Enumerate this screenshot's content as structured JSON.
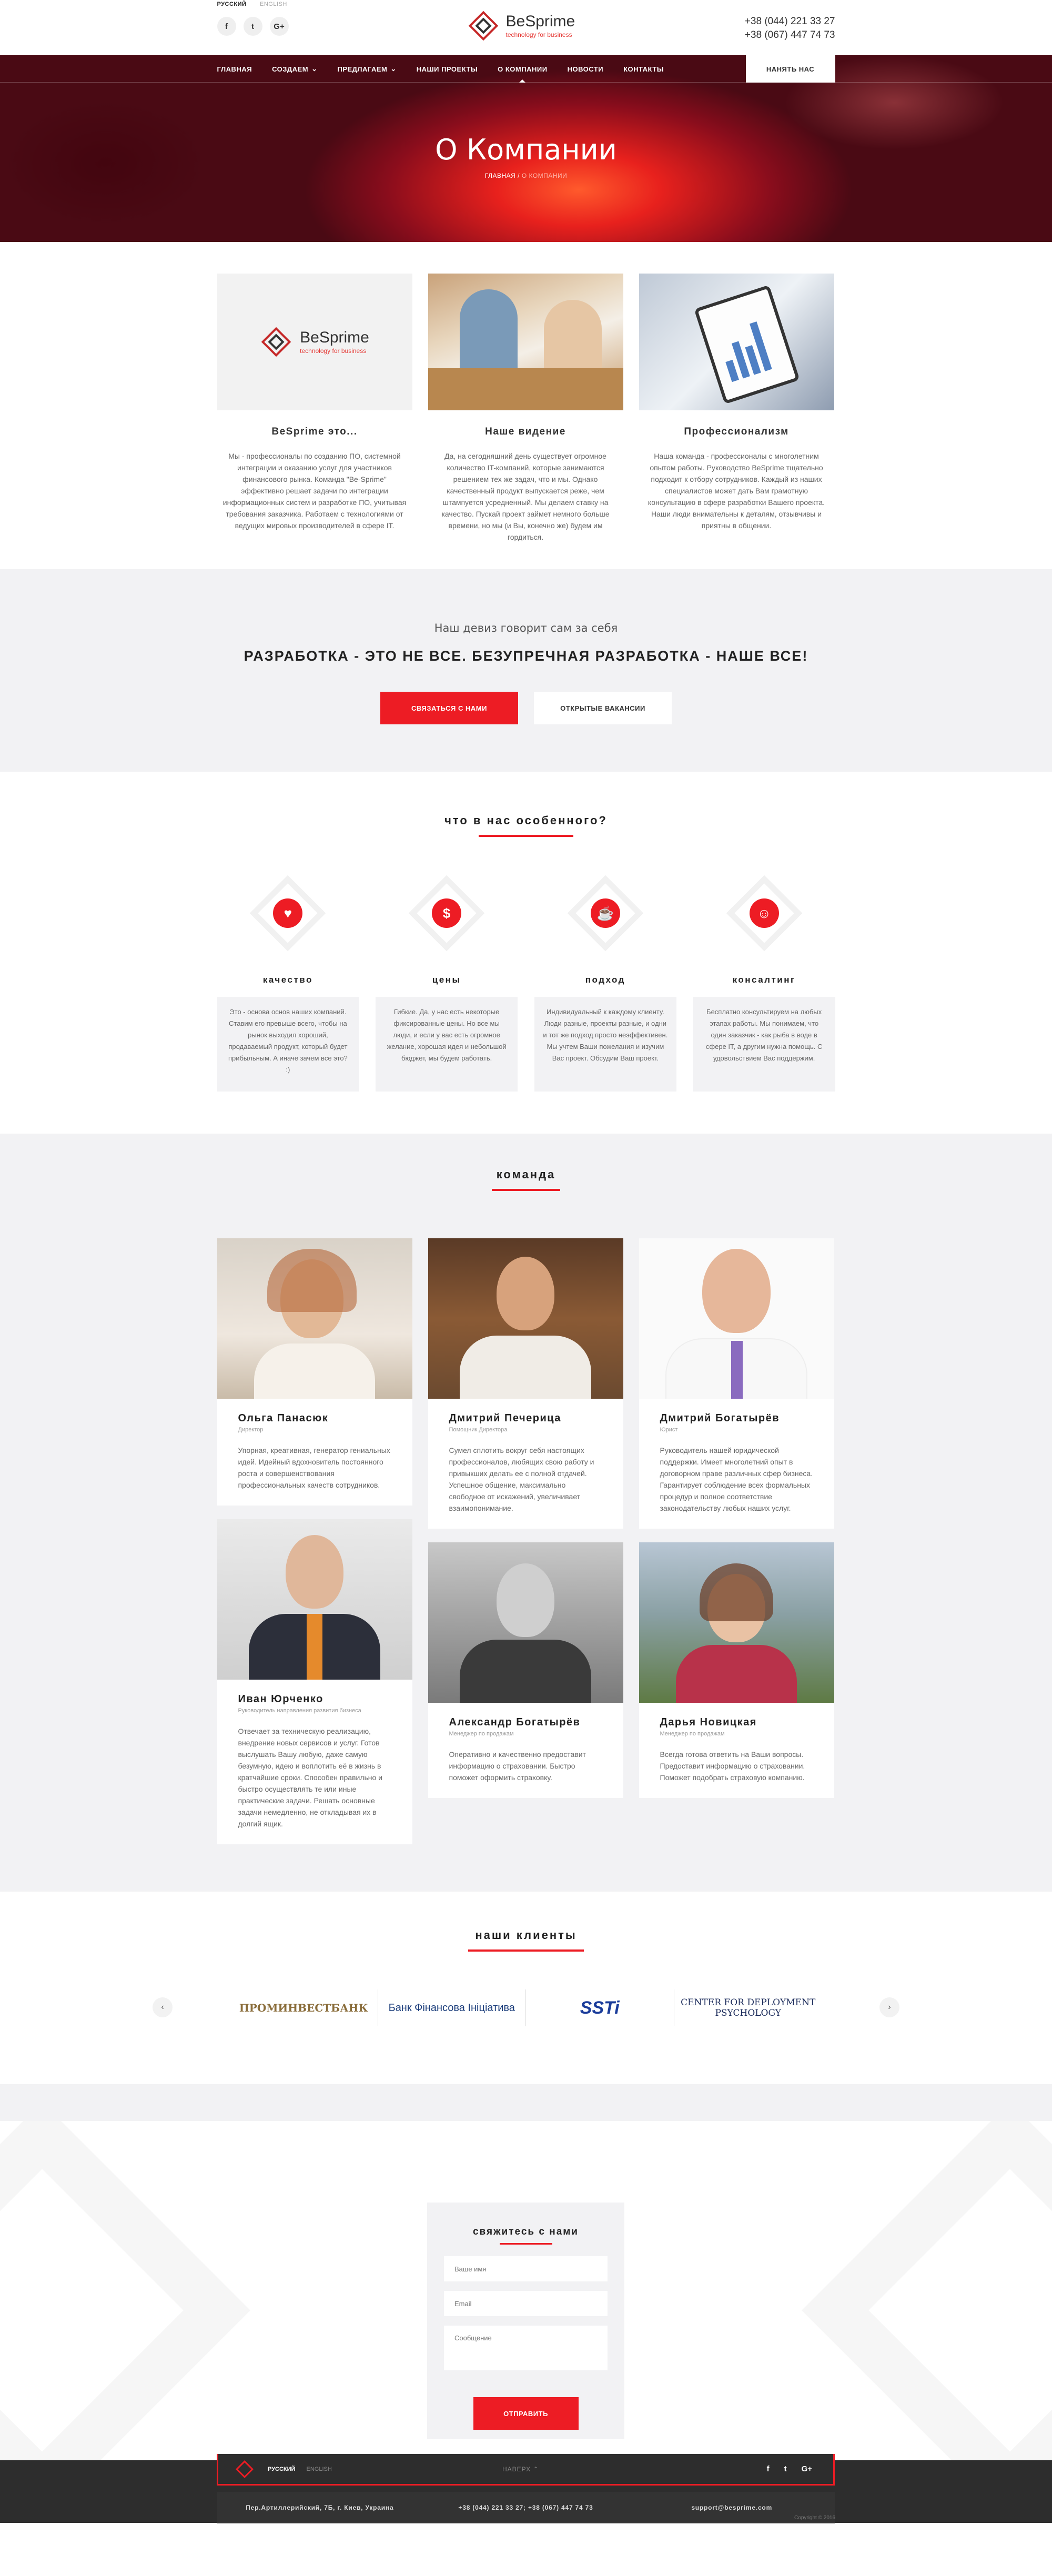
{
  "topbar": {
    "lang_active": "РУССКИЙ",
    "lang_other": "ENGLISH",
    "social": [
      "f",
      "t",
      "G+"
    ],
    "logo_name": "BeSprime",
    "logo_tagline": "technology for business",
    "phone1": "+38 (044) 221 33 27",
    "phone2": "+38 (067) 447 74 73"
  },
  "nav": {
    "items": [
      "ГЛАВНАЯ",
      "СОЗДАЕМ",
      "ПРЕДЛАГАЕМ",
      "НАШИ ПРОЕКТЫ",
      "О КОМПАНИИ",
      "НОВОСТИ",
      "КОНТАКТЫ"
    ],
    "hire": "НАНЯТЬ НАС"
  },
  "hero": {
    "title": "О Компании",
    "crumb_home": "ГЛАВНАЯ",
    "crumb_sep": " / ",
    "crumb_current": "О КОМПАНИИ"
  },
  "about": [
    {
      "title": "BeSprime это...",
      "text": "Мы - профессионалы по созданию ПО, системной интеграции и оказанию услуг для участников финансового рынка. Команда \"Be-Sprime\" эффективно решает задачи по интеграции информационных систем и разработке ПО, учитывая требования заказчика. Работаем с технологиями от ведущих мировых производителей в сфере IT."
    },
    {
      "title": "Наше видение",
      "text": "Да, на сегодняшний день существует огромное количество IT-компаний, которые занимаются решением тех же задач, что и мы. Однако качественный продукт выпускается реже, чем штампуется усредненный. Мы делаем ставку на качество. Пускай проект займет немного больше времени, но мы (и Вы, конечно же) будем им гордиться."
    },
    {
      "title": "Профессионализм",
      "text": "Наша команда - профессионалы с многолетним опытом работы. Руководство BeSprime тщательно подходит к отбору сотрудников. Каждый из наших специалистов может дать Вам грамотную консультацию в сфере разработки Вашего проекта. Наши люди внимательны к деталям, отзывчивы и приятны в общении."
    }
  ],
  "motto": {
    "subtitle": "Наш девиз говорит сам за себя",
    "main": "РАЗРАБОТКА - ЭТО НЕ ВСЕ. БЕЗУПРЕЧНАЯ РАЗРАБОТКА - НАШЕ ВСЕ!",
    "btn_contact": "СВЯЗАТЬСЯ С НАМИ",
    "btn_jobs": "ОТКРЫТЫЕ ВАКАНСИИ"
  },
  "features": {
    "title": "что в нас особенного?",
    "items": [
      {
        "title": "качество",
        "icon": "heart-hand-icon",
        "glyph": "♥",
        "text": "Это - основа основ наших компаний. Ставим его превыше всего, чтобы на рынок выходил хороший, продаваемый продукт, который будет прибыльным. А иначе зачем все это? :)"
      },
      {
        "title": "цены",
        "icon": "price-tag-icon",
        "glyph": "$",
        "text": "Гибкие. Да, у нас есть некоторые фиксированные цены. Но все мы люди, и если у вас есть огромное желание, хорошая идея и небольшой бюджет, мы будем работать."
      },
      {
        "title": "подход",
        "icon": "coffee-cup-icon",
        "glyph": "☕",
        "text": "Индивидуальный к каждому клиенту. Люди разные, проекты разные, и одни и тот же подход просто неэффективен. Мы учтем Ваши пожелания и изучим Вас проект. Обсудим Ваш проект."
      },
      {
        "title": "консалтинг",
        "icon": "consultant-icon",
        "glyph": "☺",
        "text": "Бесплатно консультируем на любых этапах работы. Мы понимаем, что один заказчик - как рыба в воде в сфере IT, а другим нужна помощь. С удовольствием Вас поддержим."
      }
    ]
  },
  "team": {
    "title": "команда",
    "members": [
      {
        "name": "Ольга Панасюк",
        "role": "Директор",
        "bio": "Упорная, креативная, генератор гениальных идей. Идейный вдохновитель постоянного роста и совершенствования профессиональных качеств сотрудников."
      },
      {
        "name": "Дмитрий Печерица",
        "role": "Помощник Директора",
        "bio": "Сумел сплотить вокруг себя настоящих профессионалов, любящих свою работу и привыкших делать ее с полной отдачей. Успешное общение, максимально свободное от искажений, увеличивает взаимопонимание."
      },
      {
        "name": "Дмитрий Богатырёв",
        "role": "Юрист",
        "bio": "Руководитель нашей юридической поддержки. Имеет многолетний опыт в договорном праве различных сфер бизнеса. Гарантирует соблюдение всех формальных процедур и полное соответствие законодательству любых наших услуг."
      },
      {
        "name": "Иван Юрченко",
        "role": "Руководитель направления развития бизнеса",
        "bio": "Отвечает за техническую реализацию, внедрение новых сервисов и услуг. Готов выслушать Вашу любую, даже самую безумную, идею и воплотить её в жизнь в кратчайшие сроки. Способен правильно и быстро осуществлять те или иные практические задачи. Решать основные задачи немедленно, не откладывая их в долгий ящик."
      },
      {
        "name": "Александр Богатырёв",
        "role": "Менеджер по продажам",
        "bio": "Оперативно и качественно предоставит информацию о страховании. Быстро поможет оформить страховку."
      },
      {
        "name": "Дарья Новицкая",
        "role": "Менеджер по продажам",
        "bio": "Всегда готова ответить на Ваши вопросы. Предоставит информацию о страховании. Поможет подобрать страховую компанию."
      }
    ]
  },
  "clients": {
    "title": "наши клиенты",
    "logos": [
      "ПРОМИНВЕСТБАНК",
      "Банк Фінансова Ініціатива",
      "SSTi",
      "CENTER FOR DEPLOYMENT PSYCHOLOGY"
    ]
  },
  "contact": {
    "title": "свяжитесь с нами",
    "ph_name": "Ваше имя",
    "ph_email": "Email",
    "ph_message": "Сообщение",
    "send": "ОТПРАВИТЬ"
  },
  "footer": {
    "lang_active": "РУССКИЙ",
    "lang_other": "ENGLISH",
    "up": "НАВЕРХ ⌃",
    "social": [
      "f",
      "t",
      "G+"
    ],
    "address": "Пер.Артиллерийский, 7Б, г. Киев, Украина",
    "phones": "+38 (044) 221 33 27; +38 (067) 447 74 73",
    "email": "support@besprime.com",
    "copyright": "Copyright © 2016"
  },
  "colors": {
    "accent": "#ed1c24",
    "dark": "#2d2d2d",
    "light_bg": "#f2f2f4"
  }
}
